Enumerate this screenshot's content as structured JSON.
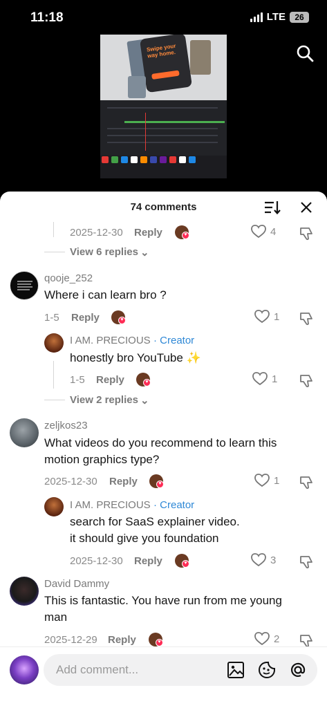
{
  "status_bar": {
    "time": "11:18",
    "network": "LTE",
    "battery": "26"
  },
  "video_overlay_text": "Swipe your way home.",
  "comments_sheet": {
    "title": "74 comments"
  },
  "thread1_tail": {
    "date": "2025-12-30",
    "reply_label": "Reply",
    "likes": "4",
    "view_replies": "View 6 replies"
  },
  "comments": [
    {
      "username": "qooje_252",
      "text": "Where i can learn bro ?",
      "date": "1-5",
      "reply_label": "Reply",
      "likes": "1",
      "reply": {
        "username": "I AM. PRECIOUS",
        "badge": "· Creator",
        "text": "honestly bro YouTube ✨",
        "date": "1-5",
        "reply_label": "Reply",
        "likes": "1"
      },
      "view_replies": "View 2 replies"
    },
    {
      "username": "zeljkos23",
      "text_line1": "What videos do you recommend to learn this",
      "text_line2": "motion graphics type?",
      "date": "2025-12-30",
      "reply_label": "Reply",
      "likes": "1",
      "reply": {
        "username": "I AM. PRECIOUS",
        "badge": "· Creator",
        "text_line1": "search for SaaS explainer video.",
        "text_line2": "it should give you foundation",
        "date": "2025-12-30",
        "reply_label": "Reply",
        "likes": "3"
      }
    },
    {
      "username": "David Dammy",
      "text_line1": "This is fantastic. You have run from me young",
      "text_line2": "man",
      "date": "2025-12-29",
      "reply_label": "Reply",
      "likes": "2"
    }
  ],
  "composer": {
    "placeholder": "Add comment..."
  },
  "colors": {
    "creator_badge": "#2e88d6",
    "heart_badge": "#fe2c55"
  }
}
